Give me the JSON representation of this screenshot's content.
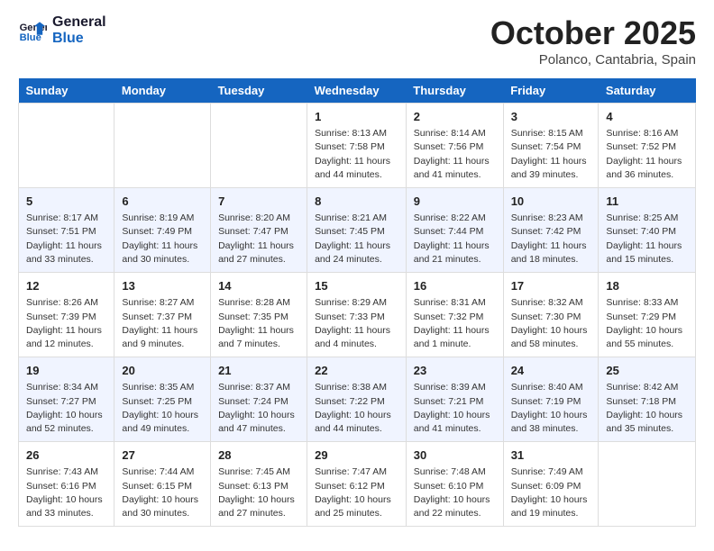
{
  "header": {
    "logo_line1": "General",
    "logo_line2": "Blue",
    "month": "October 2025",
    "location": "Polanco, Cantabria, Spain"
  },
  "days_of_week": [
    "Sunday",
    "Monday",
    "Tuesday",
    "Wednesday",
    "Thursday",
    "Friday",
    "Saturday"
  ],
  "weeks": [
    [
      {
        "day": "",
        "info": ""
      },
      {
        "day": "",
        "info": ""
      },
      {
        "day": "",
        "info": ""
      },
      {
        "day": "1",
        "info": "Sunrise: 8:13 AM\nSunset: 7:58 PM\nDaylight: 11 hours and 44 minutes."
      },
      {
        "day": "2",
        "info": "Sunrise: 8:14 AM\nSunset: 7:56 PM\nDaylight: 11 hours and 41 minutes."
      },
      {
        "day": "3",
        "info": "Sunrise: 8:15 AM\nSunset: 7:54 PM\nDaylight: 11 hours and 39 minutes."
      },
      {
        "day": "4",
        "info": "Sunrise: 8:16 AM\nSunset: 7:52 PM\nDaylight: 11 hours and 36 minutes."
      }
    ],
    [
      {
        "day": "5",
        "info": "Sunrise: 8:17 AM\nSunset: 7:51 PM\nDaylight: 11 hours and 33 minutes."
      },
      {
        "day": "6",
        "info": "Sunrise: 8:19 AM\nSunset: 7:49 PM\nDaylight: 11 hours and 30 minutes."
      },
      {
        "day": "7",
        "info": "Sunrise: 8:20 AM\nSunset: 7:47 PM\nDaylight: 11 hours and 27 minutes."
      },
      {
        "day": "8",
        "info": "Sunrise: 8:21 AM\nSunset: 7:45 PM\nDaylight: 11 hours and 24 minutes."
      },
      {
        "day": "9",
        "info": "Sunrise: 8:22 AM\nSunset: 7:44 PM\nDaylight: 11 hours and 21 minutes."
      },
      {
        "day": "10",
        "info": "Sunrise: 8:23 AM\nSunset: 7:42 PM\nDaylight: 11 hours and 18 minutes."
      },
      {
        "day": "11",
        "info": "Sunrise: 8:25 AM\nSunset: 7:40 PM\nDaylight: 11 hours and 15 minutes."
      }
    ],
    [
      {
        "day": "12",
        "info": "Sunrise: 8:26 AM\nSunset: 7:39 PM\nDaylight: 11 hours and 12 minutes."
      },
      {
        "day": "13",
        "info": "Sunrise: 8:27 AM\nSunset: 7:37 PM\nDaylight: 11 hours and 9 minutes."
      },
      {
        "day": "14",
        "info": "Sunrise: 8:28 AM\nSunset: 7:35 PM\nDaylight: 11 hours and 7 minutes."
      },
      {
        "day": "15",
        "info": "Sunrise: 8:29 AM\nSunset: 7:33 PM\nDaylight: 11 hours and 4 minutes."
      },
      {
        "day": "16",
        "info": "Sunrise: 8:31 AM\nSunset: 7:32 PM\nDaylight: 11 hours and 1 minute."
      },
      {
        "day": "17",
        "info": "Sunrise: 8:32 AM\nSunset: 7:30 PM\nDaylight: 10 hours and 58 minutes."
      },
      {
        "day": "18",
        "info": "Sunrise: 8:33 AM\nSunset: 7:29 PM\nDaylight: 10 hours and 55 minutes."
      }
    ],
    [
      {
        "day": "19",
        "info": "Sunrise: 8:34 AM\nSunset: 7:27 PM\nDaylight: 10 hours and 52 minutes."
      },
      {
        "day": "20",
        "info": "Sunrise: 8:35 AM\nSunset: 7:25 PM\nDaylight: 10 hours and 49 minutes."
      },
      {
        "day": "21",
        "info": "Sunrise: 8:37 AM\nSunset: 7:24 PM\nDaylight: 10 hours and 47 minutes."
      },
      {
        "day": "22",
        "info": "Sunrise: 8:38 AM\nSunset: 7:22 PM\nDaylight: 10 hours and 44 minutes."
      },
      {
        "day": "23",
        "info": "Sunrise: 8:39 AM\nSunset: 7:21 PM\nDaylight: 10 hours and 41 minutes."
      },
      {
        "day": "24",
        "info": "Sunrise: 8:40 AM\nSunset: 7:19 PM\nDaylight: 10 hours and 38 minutes."
      },
      {
        "day": "25",
        "info": "Sunrise: 8:42 AM\nSunset: 7:18 PM\nDaylight: 10 hours and 35 minutes."
      }
    ],
    [
      {
        "day": "26",
        "info": "Sunrise: 7:43 AM\nSunset: 6:16 PM\nDaylight: 10 hours and 33 minutes."
      },
      {
        "day": "27",
        "info": "Sunrise: 7:44 AM\nSunset: 6:15 PM\nDaylight: 10 hours and 30 minutes."
      },
      {
        "day": "28",
        "info": "Sunrise: 7:45 AM\nSunset: 6:13 PM\nDaylight: 10 hours and 27 minutes."
      },
      {
        "day": "29",
        "info": "Sunrise: 7:47 AM\nSunset: 6:12 PM\nDaylight: 10 hours and 25 minutes."
      },
      {
        "day": "30",
        "info": "Sunrise: 7:48 AM\nSunset: 6:10 PM\nDaylight: 10 hours and 22 minutes."
      },
      {
        "day": "31",
        "info": "Sunrise: 7:49 AM\nSunset: 6:09 PM\nDaylight: 10 hours and 19 minutes."
      },
      {
        "day": "",
        "info": ""
      }
    ]
  ]
}
